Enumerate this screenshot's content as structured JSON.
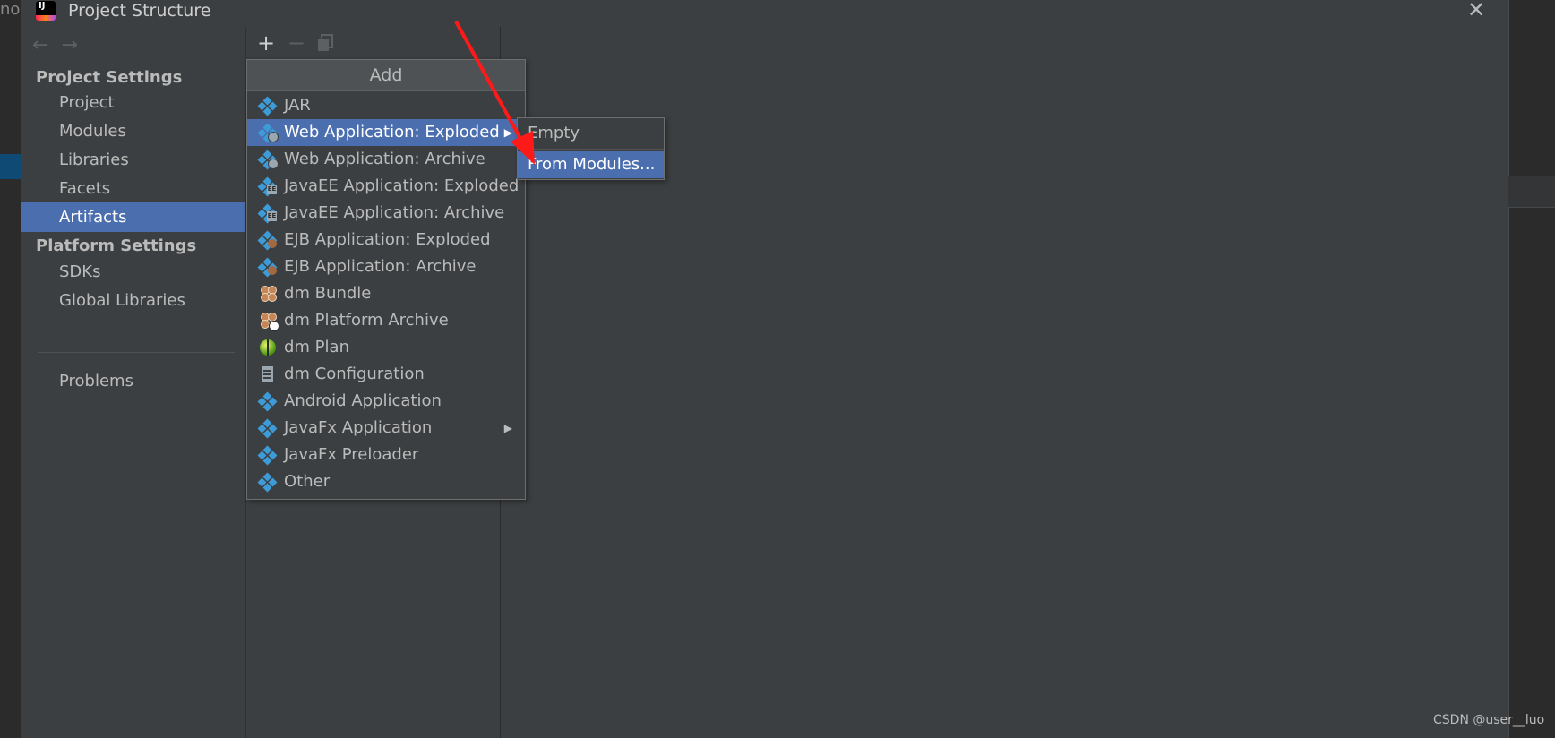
{
  "background": {
    "left_fragment": "nop"
  },
  "window": {
    "title": "Project Structure",
    "app_icon_label": "IJ",
    "close_icon": "close-icon"
  },
  "nav": {
    "back_icon": "arrow-left-icon",
    "forward_icon": "arrow-right-icon"
  },
  "sidebar": {
    "project_settings_heading": "Project Settings",
    "platform_settings_heading": "Platform Settings",
    "items": [
      {
        "label": "Project"
      },
      {
        "label": "Modules"
      },
      {
        "label": "Libraries"
      },
      {
        "label": "Facets"
      },
      {
        "label": "Artifacts",
        "selected": true
      },
      {
        "label": "SDKs"
      },
      {
        "label": "Global Libraries"
      },
      {
        "label": "Problems"
      }
    ]
  },
  "toolbar": {
    "add": "+",
    "remove": "−",
    "copy_icon": "copy-icon"
  },
  "add_menu": {
    "header": "Add",
    "items": [
      {
        "label": "JAR",
        "icon": "artifact-icon"
      },
      {
        "label": "Web Application: Exploded",
        "icon": "web-artifact-icon",
        "submenu": true,
        "highlighted": true
      },
      {
        "label": "Web Application: Archive",
        "icon": "web-artifact-icon"
      },
      {
        "label": "JavaEE Application: Exploded",
        "icon": "javaee-artifact-icon"
      },
      {
        "label": "JavaEE Application: Archive",
        "icon": "javaee-artifact-icon"
      },
      {
        "label": "EJB Application: Exploded",
        "icon": "ejb-artifact-icon"
      },
      {
        "label": "EJB Application: Archive",
        "icon": "ejb-artifact-icon"
      },
      {
        "label": "dm Bundle",
        "icon": "bundle-icon"
      },
      {
        "label": "dm Platform Archive",
        "icon": "platform-archive-icon"
      },
      {
        "label": "dm Plan",
        "icon": "plan-icon"
      },
      {
        "label": "dm Configuration",
        "icon": "configuration-icon"
      },
      {
        "label": "Android Application",
        "icon": "artifact-icon"
      },
      {
        "label": "JavaFx Application",
        "icon": "artifact-icon",
        "submenu": true
      },
      {
        "label": "JavaFx Preloader",
        "icon": "artifact-icon"
      },
      {
        "label": "Other",
        "icon": "artifact-icon"
      }
    ]
  },
  "submenu": {
    "items": [
      {
        "label": "Empty"
      },
      {
        "label": "From Modules...",
        "highlighted": true
      }
    ]
  },
  "colors": {
    "selection": "#4b6eaf",
    "panel": "#3c3f41",
    "annotation_arrow": "#ff1a1a",
    "artifact_icon": "#3d9bd7"
  },
  "watermark": "CSDN @user__luo"
}
